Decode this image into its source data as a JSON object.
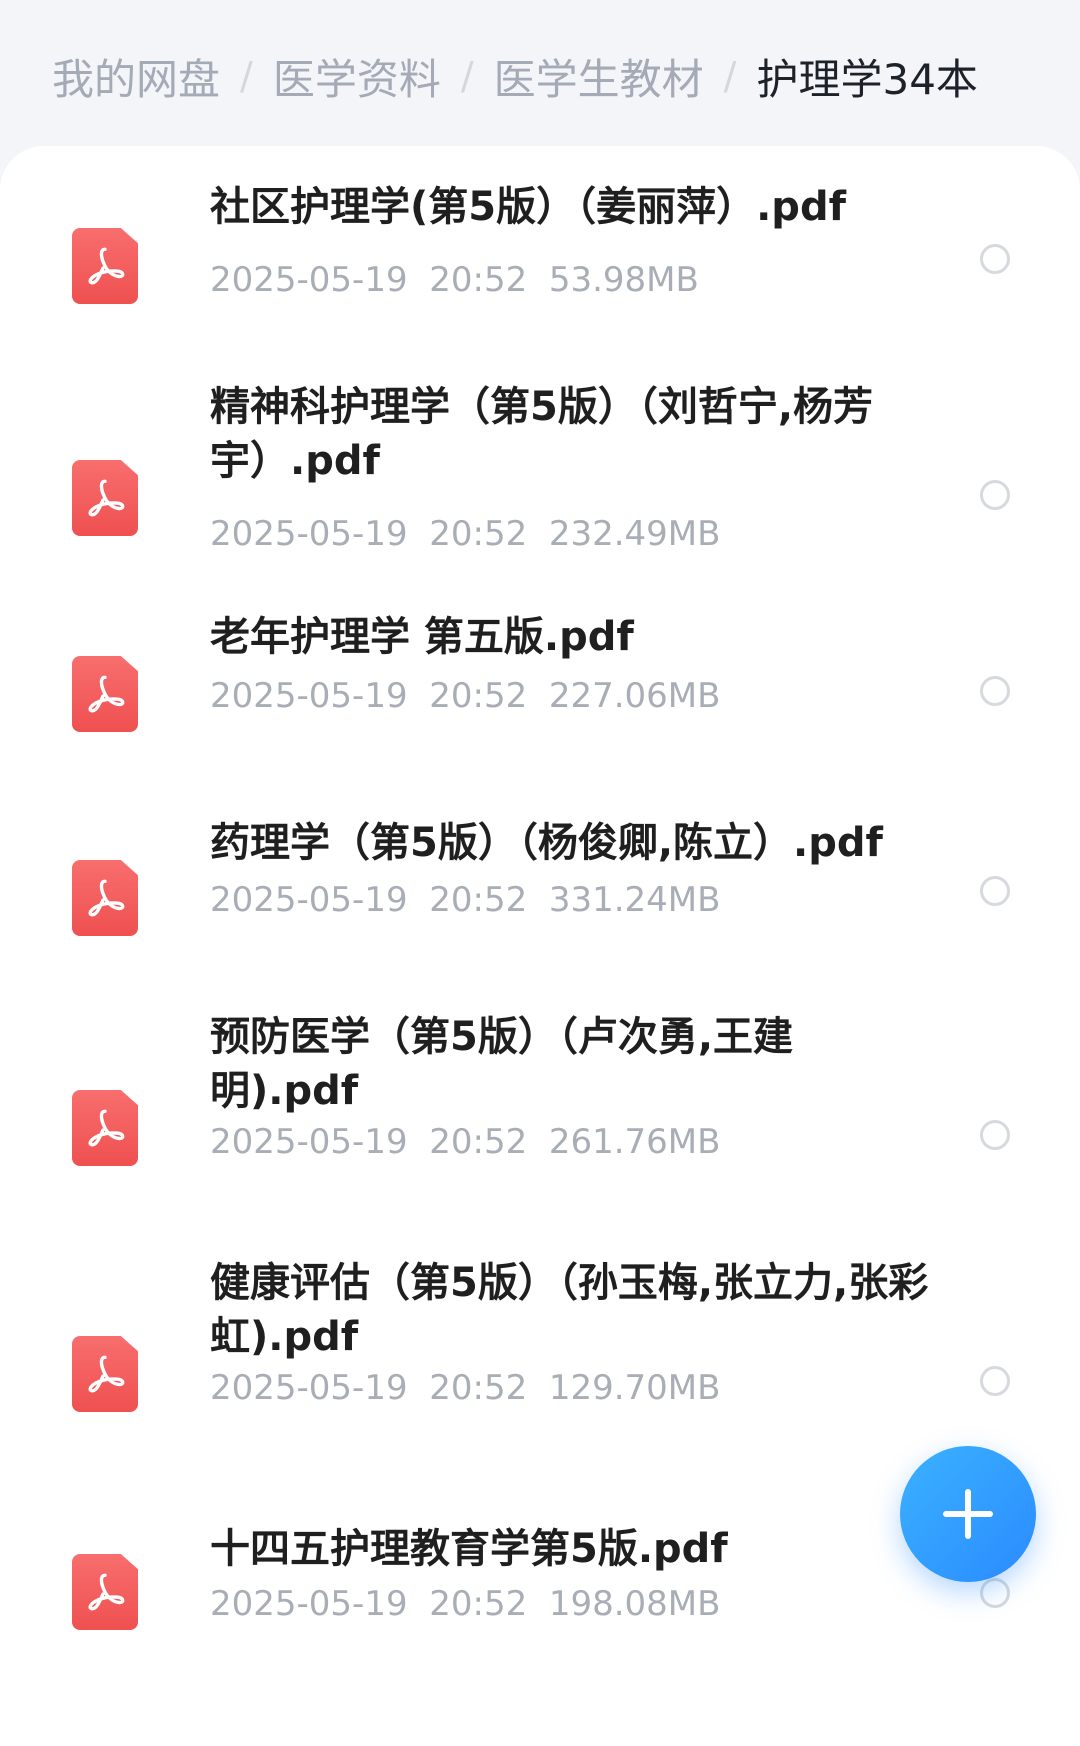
{
  "breadcrumb": {
    "items": [
      "我的网盘",
      "医学资料",
      "医学生教材",
      "护理学34本"
    ],
    "separator": "/"
  },
  "files": [
    {
      "name": "社区护理学(第5版）（姜丽萍）.pdf",
      "date": "2025-05-19",
      "time": "20:52",
      "size": "53.98MB",
      "icon": "pdf-icon"
    },
    {
      "name": "精神科护理学（第5版）（刘哲宁,杨芳宇）.pdf",
      "date": "2025-05-19",
      "time": "20:52",
      "size": "232.49MB",
      "icon": "pdf-icon"
    },
    {
      "name": "老年护理学 第五版.pdf",
      "date": "2025-05-19",
      "time": "20:52",
      "size": "227.06MB",
      "icon": "pdf-icon"
    },
    {
      "name": "药理学（第5版）（杨俊卿,陈立）.pdf",
      "date": "2025-05-19",
      "time": "20:52",
      "size": "331.24MB",
      "icon": "pdf-icon"
    },
    {
      "name": "预防医学（第5版）（卢次勇,王建明).pdf",
      "date": "2025-05-19",
      "time": "20:52",
      "size": "261.76MB",
      "icon": "pdf-icon"
    },
    {
      "name": "健康评估（第5版）（孙玉梅,张立力,张彩虹).pdf",
      "date": "2025-05-19",
      "time": "20:52",
      "size": "129.70MB",
      "icon": "pdf-icon"
    },
    {
      "name": "十四五护理教育学第5版.pdf",
      "date": "2025-05-19",
      "time": "20:52",
      "size": "198.08MB",
      "icon": "pdf-icon"
    }
  ],
  "fab": {
    "icon": "plus-icon"
  },
  "colors": {
    "accent": "#2a8bff",
    "pdf": "#ef5050",
    "meta_text": "#a8adb6"
  }
}
